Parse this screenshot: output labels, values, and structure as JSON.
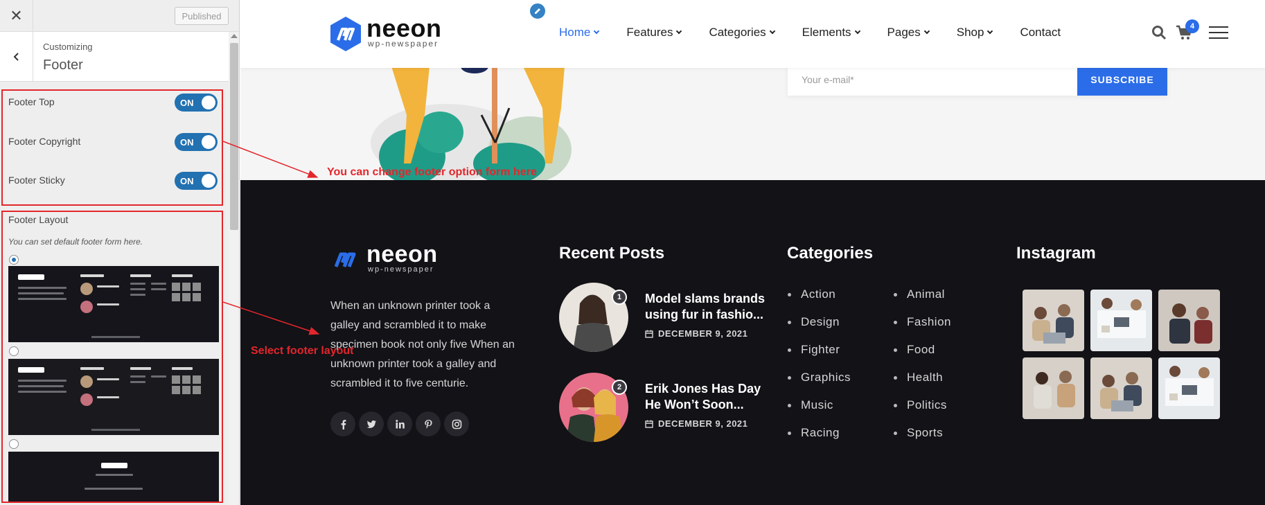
{
  "customizer": {
    "close_icon": "close-icon",
    "publish_label": "Published",
    "breadcrumb": "Customizing",
    "section_title": "Footer",
    "toggles": [
      {
        "label": "Footer Top",
        "state": "ON"
      },
      {
        "label": "Footer Copyright",
        "state": "ON"
      },
      {
        "label": "Footer Sticky",
        "state": "ON"
      }
    ],
    "layout_title": "Footer Layout",
    "layout_description": "You can set default footer form here.",
    "layout_options": [
      {
        "selected": true
      },
      {
        "selected": false
      },
      {
        "selected": false
      }
    ]
  },
  "annotations": {
    "toggles": "You can change footer option form here",
    "layout": "Select footer layout"
  },
  "site": {
    "logo_text": "neeon",
    "logo_sub": "wp-newspaper",
    "brand_color": "#2b6de8",
    "menu": [
      {
        "label": "Home",
        "dropdown": true,
        "active": true
      },
      {
        "label": "Features",
        "dropdown": true
      },
      {
        "label": "Categories",
        "dropdown": true
      },
      {
        "label": "Elements",
        "dropdown": true
      },
      {
        "label": "Pages",
        "dropdown": true
      },
      {
        "label": "Shop",
        "dropdown": true
      },
      {
        "label": "Contact",
        "dropdown": false
      }
    ],
    "cart_count": "4"
  },
  "newsletter": {
    "placeholder": "Your e-mail*",
    "button": "SUBSCRIBE"
  },
  "footer": {
    "logo_text": "neeon",
    "logo_sub": "wp-newspaper",
    "description": "When an unknown printer took a galley and scrambled it to make specimen book not only five When an unknown printer took a galley and scrambled it to five centurie.",
    "socials": [
      "facebook-icon",
      "twitter-icon",
      "linkedin-icon",
      "pinterest-icon",
      "instagram-icon"
    ],
    "recent_posts_title": "Recent Posts",
    "posts": [
      {
        "num": "1",
        "title": "Model slams brands using fur in fashio...",
        "date": "DECEMBER 9, 2021"
      },
      {
        "num": "2",
        "title": "Erik Jones Has Day He Won’t Soon...",
        "date": "DECEMBER 9, 2021"
      }
    ],
    "categories_title": "Categories",
    "categories_left": [
      "Action",
      "Design",
      "Fighter",
      "Graphics",
      "Music",
      "Racing"
    ],
    "categories_right": [
      "Animal",
      "Fashion",
      "Food",
      "Health",
      "Politics",
      "Sports"
    ],
    "instagram_title": "Instagram"
  }
}
